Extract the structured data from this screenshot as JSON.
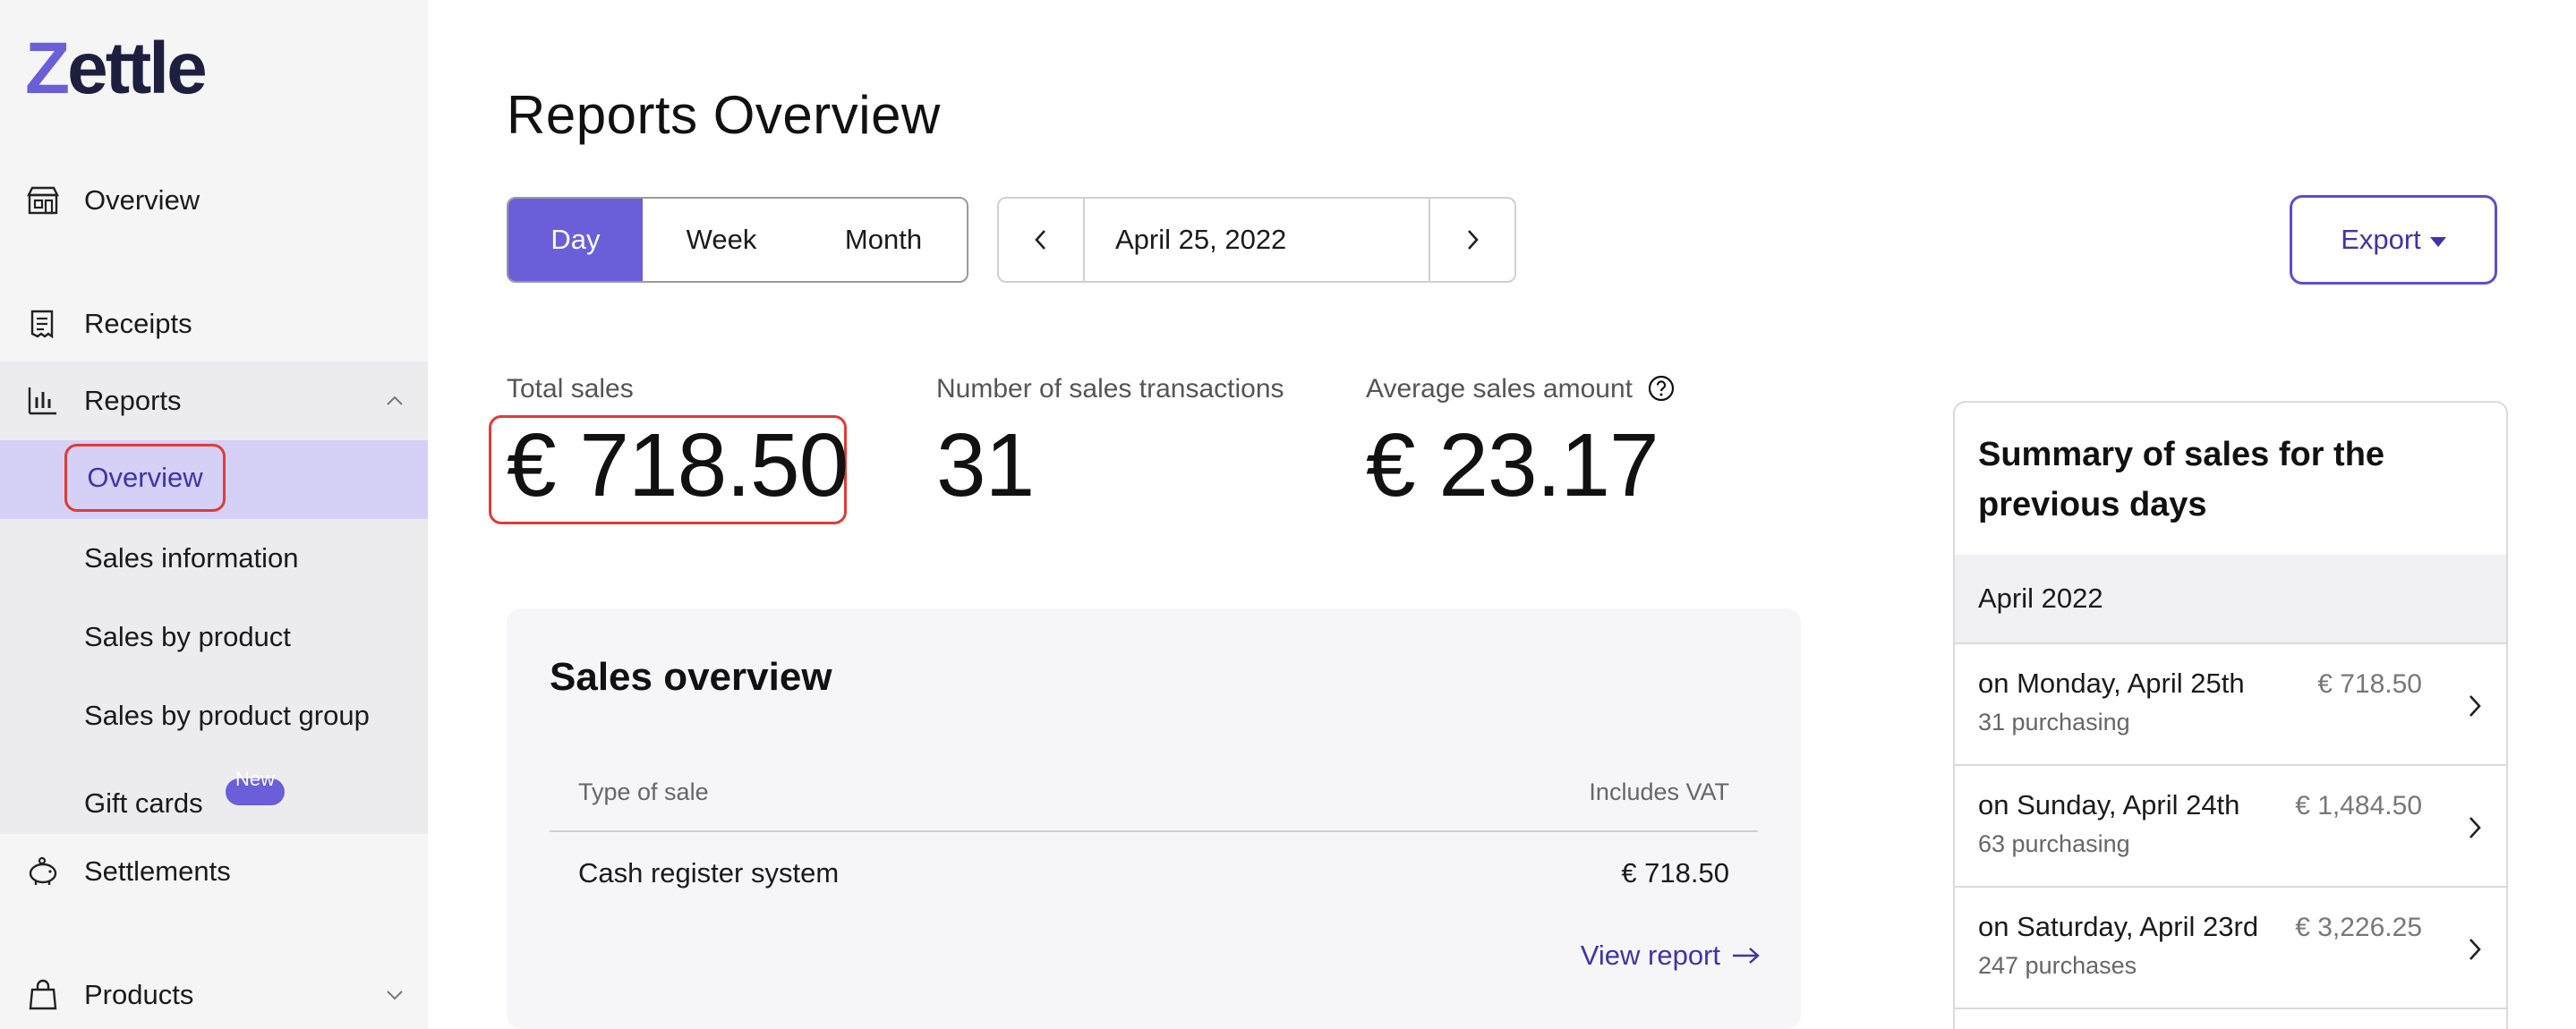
{
  "app": {
    "logo_first": "Z",
    "logo_rest": "ettle"
  },
  "sidebar": {
    "overview": "Overview",
    "receipts": "Receipts",
    "reports": "Reports",
    "reports_sub": {
      "overview": "Overview",
      "sales_information": "Sales information",
      "sales_by_product": "Sales by product",
      "sales_by_product_group": "Sales by product group",
      "gift_cards": "Gift cards",
      "gift_cards_badge": "New"
    },
    "settlements": "Settlements",
    "products": "Products"
  },
  "header": {
    "title": "Reports Overview"
  },
  "period": {
    "day": "Day",
    "week": "Week",
    "month": "Month",
    "selected": "Day"
  },
  "date": {
    "value": "April 25, 2022"
  },
  "export": {
    "label": "Export"
  },
  "metrics": {
    "total_sales_label": "Total sales",
    "total_sales_value": "€ 718.50",
    "transactions_label": "Number of sales transactions",
    "transactions_value": "31",
    "average_label": "Average sales amount",
    "average_value": "€ 23.17"
  },
  "sales_overview": {
    "title": "Sales overview",
    "col_type": "Type of sale",
    "col_vat": "Includes VAT",
    "rows": [
      {
        "type": "Cash register system",
        "amount": "€ 718.50"
      }
    ],
    "view_report": "View report"
  },
  "summary": {
    "title": "Summary of sales for the previous days",
    "month": "April 2022",
    "days": [
      {
        "day": "on Monday, April 25th",
        "count": "31 purchasing",
        "amount": "€ 718.50"
      },
      {
        "day": "on Sunday, April 24th",
        "count": "63 purchasing",
        "amount": "€ 1,484.50"
      },
      {
        "day": "on Saturday, April 23rd",
        "count": "247 purchases",
        "amount": "€ 3,226.25"
      }
    ]
  },
  "colors": {
    "accent": "#6a5fd8",
    "accent_text": "#3d35a6",
    "highlight_red": "#e03b35",
    "active_nav_bg": "#d4d0f6"
  }
}
